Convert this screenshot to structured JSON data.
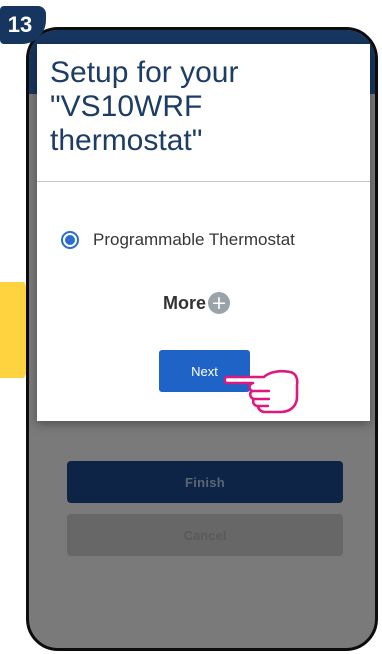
{
  "step": {
    "number": "13"
  },
  "dialog": {
    "title": "Setup for your \"VS10WRF thermostat\"",
    "option_label": "Programmable Thermostat",
    "option_selected": true,
    "more_label": "More",
    "more_icon": "plus-circle-icon",
    "next_label": "Next"
  },
  "background_screen": {
    "finish_label": "Finish",
    "cancel_label": "Cancel"
  },
  "pointer": {
    "icon": "tap-hand-icon"
  },
  "colors": {
    "accent_blue": "#1f63c6",
    "title_navy": "#1d3c66",
    "badge_navy": "#17365f",
    "arrow_yellow": "#ffd23f",
    "hand_pink": "#e0177c"
  }
}
